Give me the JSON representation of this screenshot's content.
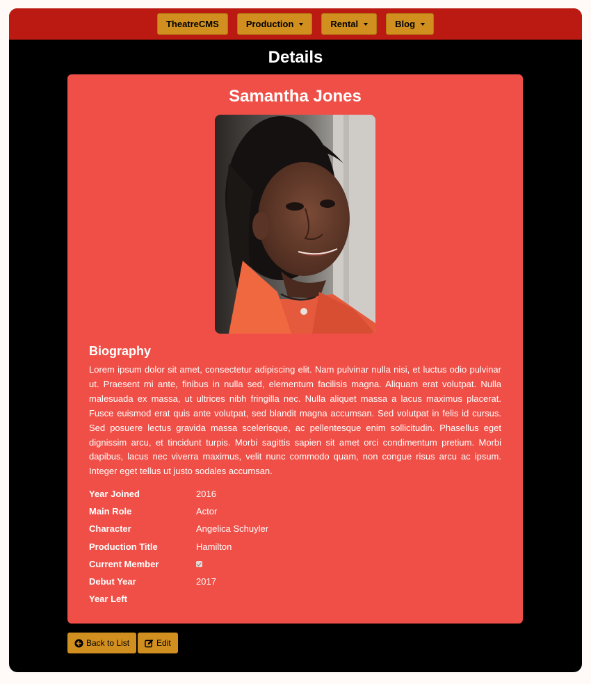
{
  "nav": {
    "brand": "TheatreCMS",
    "items": [
      {
        "label": "Production"
      },
      {
        "label": "Rental"
      },
      {
        "label": "Blog"
      }
    ]
  },
  "page": {
    "title": "Details"
  },
  "member": {
    "name": "Samantha Jones",
    "bio_heading": "Biography",
    "bio": "Lorem ipsum dolor sit amet, consectetur adipiscing elit. Nam pulvinar nulla nisi, et luctus odio pulvinar ut. Praesent mi ante, finibus in nulla sed, elementum facilisis magna. Aliquam erat volutpat. Nulla malesuada ex massa, ut ultrices nibh fringilla nec. Nulla aliquet massa a lacus maximus placerat. Fusce euismod erat quis ante volutpat, sed blandit magna accumsan. Sed volutpat in felis id cursus. Sed posuere lectus gravida massa scelerisque, ac pellentesque enim sollicitudin. Phasellus eget dignissim arcu, et tincidunt turpis. Morbi sagittis sapien sit amet orci condimentum pretium. Morbi dapibus, lacus nec viverra maximus, velit nunc commodo quam, non congue risus arcu ac ipsum. Integer eget tellus ut justo sodales accumsan.",
    "details": {
      "year_joined_label": "Year Joined",
      "year_joined": "2016",
      "main_role_label": "Main Role",
      "main_role": "Actor",
      "character_label": "Character",
      "character": "Angelica Schuyler",
      "production_title_label": "Production Title",
      "production_title": "Hamilton",
      "current_member_label": "Current Member",
      "current_member": true,
      "debut_year_label": "Debut Year",
      "debut_year": "2017",
      "year_left_label": "Year Left",
      "year_left": ""
    }
  },
  "actions": {
    "back_label": "Back to List",
    "edit_label": "Edit"
  },
  "colors": {
    "navbar": "#bb1a13",
    "card": "#ef4f47",
    "button": "#d18f20",
    "background": "#000000"
  },
  "icons": {
    "back": "circle-arrow-left-icon",
    "edit": "edit-icon"
  }
}
